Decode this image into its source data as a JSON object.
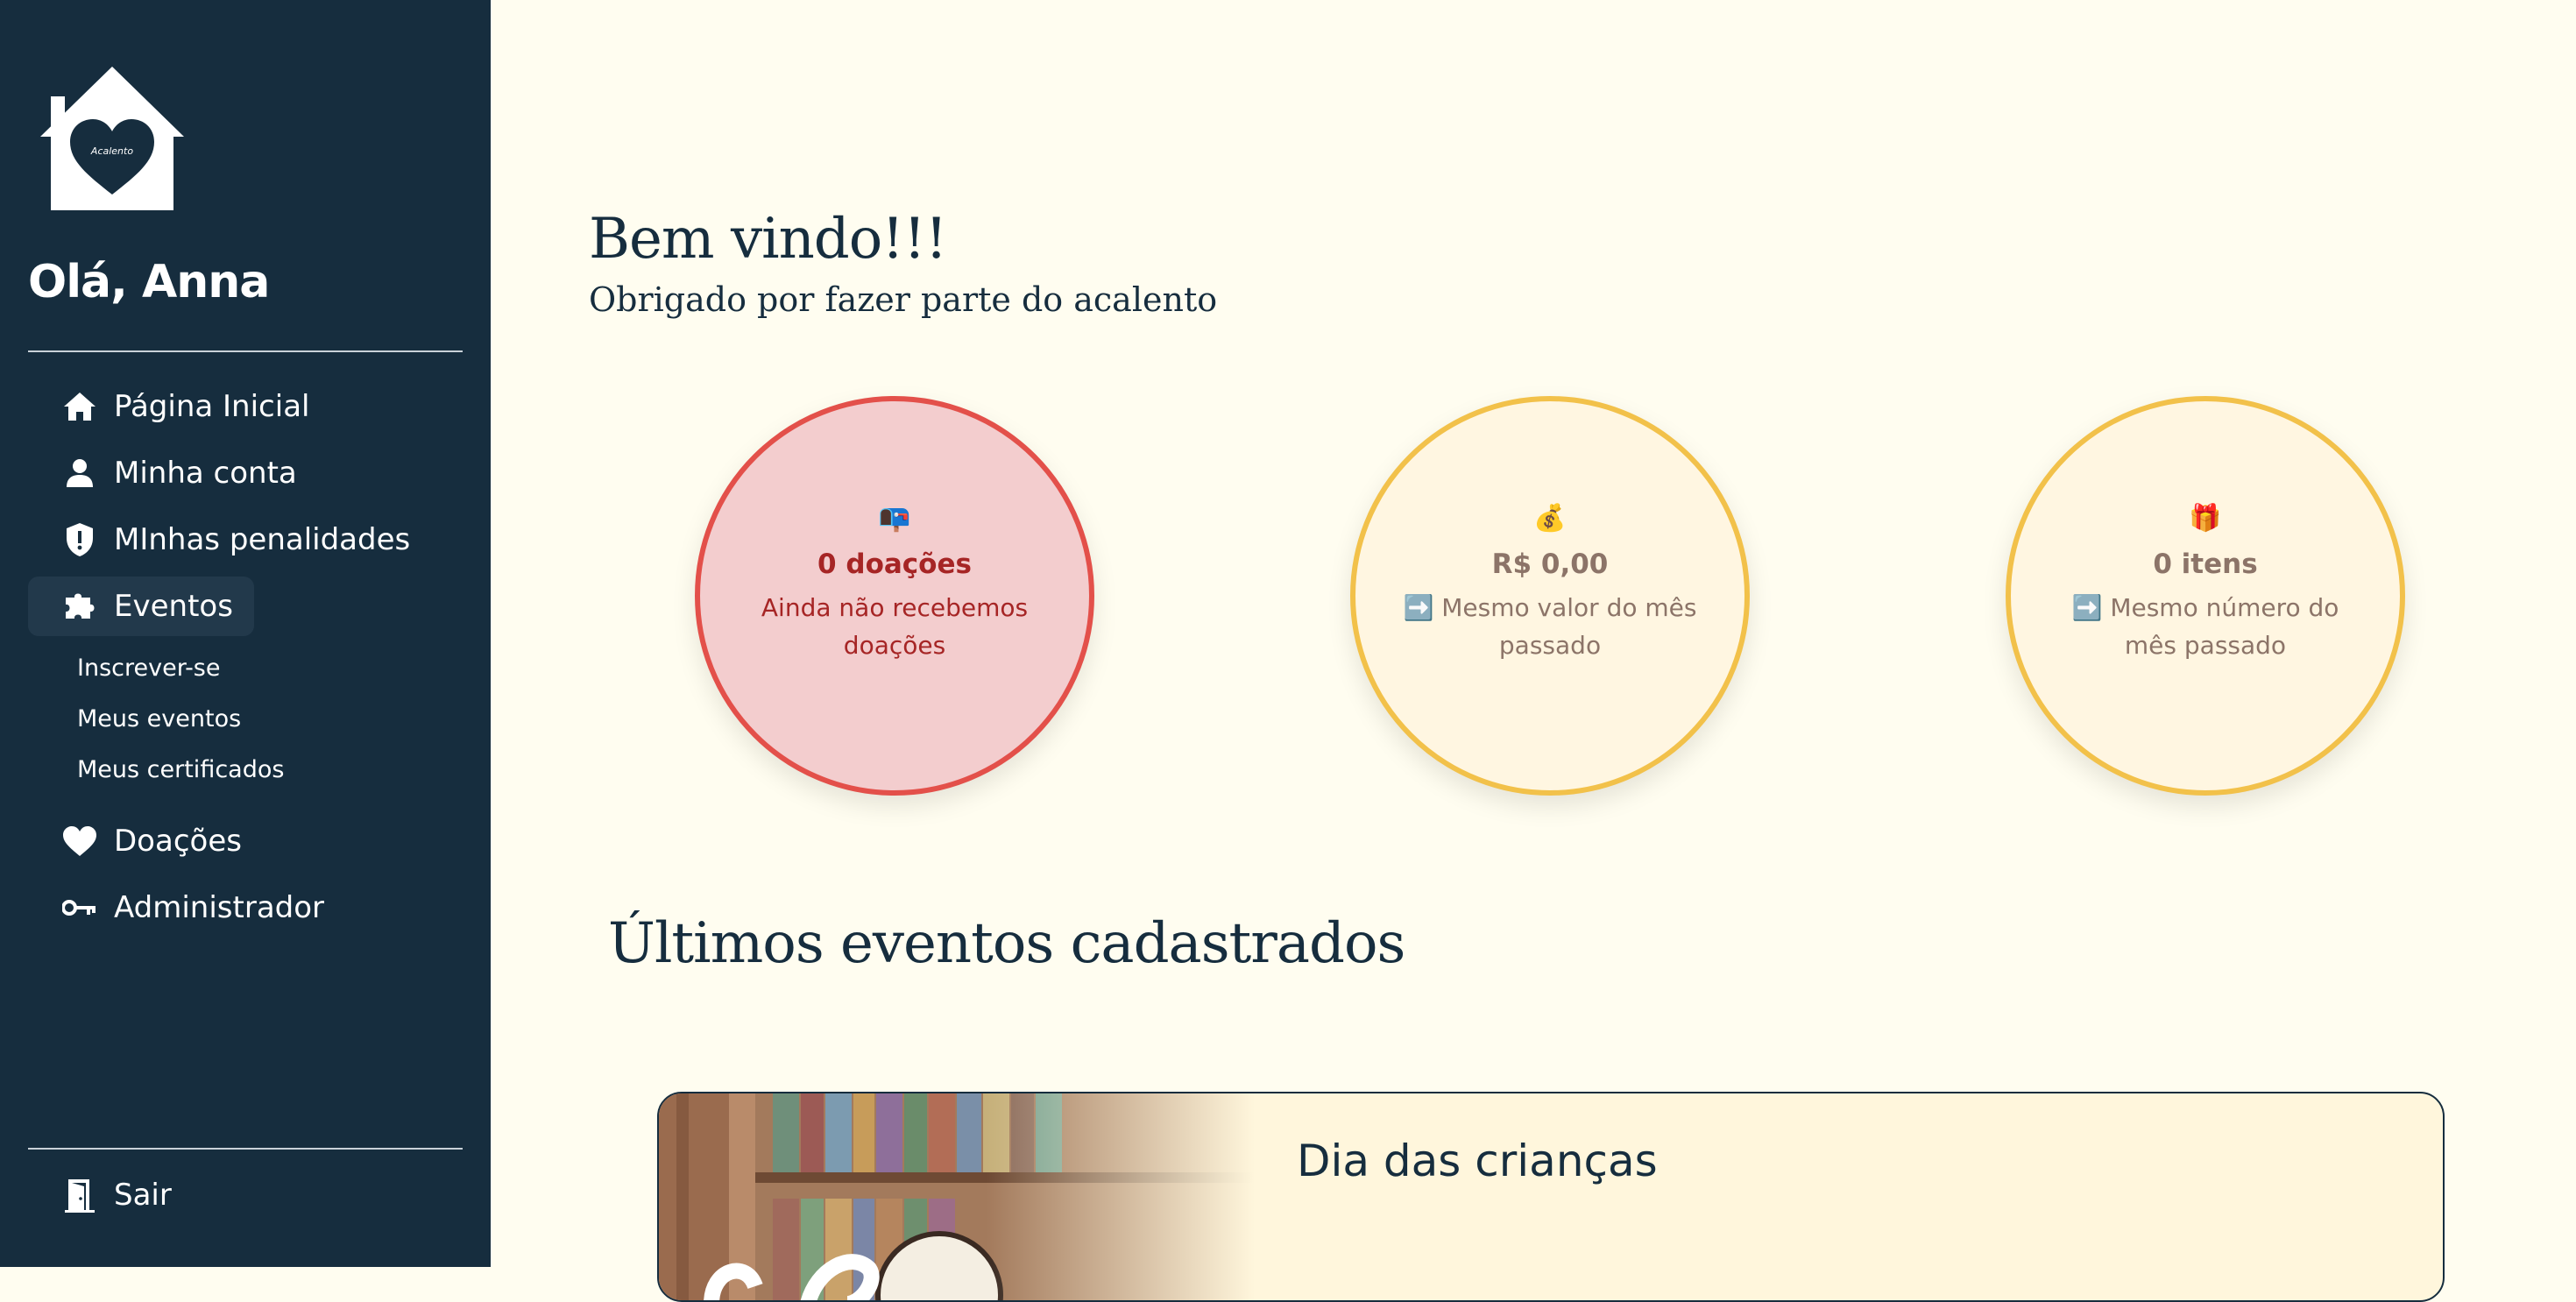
{
  "sidebar": {
    "logo_text": "Acalento",
    "greeting": "Olá, Anna",
    "nav": {
      "home": "Página Inicial",
      "account": "Minha conta",
      "penalties": "MInhas penalidades",
      "events": "Eventos",
      "events_sub": [
        "Inscrever-se",
        "Meus eventos",
        "Meus certificados"
      ],
      "donations": "Doações",
      "admin": "Administrador"
    },
    "logout": "Sair"
  },
  "main": {
    "title": "Bem vindo!!!",
    "subtitle": "Obrigado por fazer parte do acalento",
    "stats": [
      {
        "emoji": "📭",
        "value": "0 doações",
        "desc": "Ainda não recebemos doações"
      },
      {
        "emoji": "💰",
        "value": "R$ 0,00",
        "desc": "➡️ Mesmo valor do mês passado"
      },
      {
        "emoji": "🎁",
        "value": "0 itens",
        "desc": "➡️ Mesmo número do mês passado"
      }
    ],
    "events_title": "Últimos eventos cadastrados",
    "events": [
      {
        "title": "Dia das crianças"
      }
    ]
  },
  "colors": {
    "sidebar_bg": "#162D3E",
    "page_bg": "#FFFDF0",
    "accent_yellow": "#F2C14A",
    "accent_red": "#E3504A"
  }
}
